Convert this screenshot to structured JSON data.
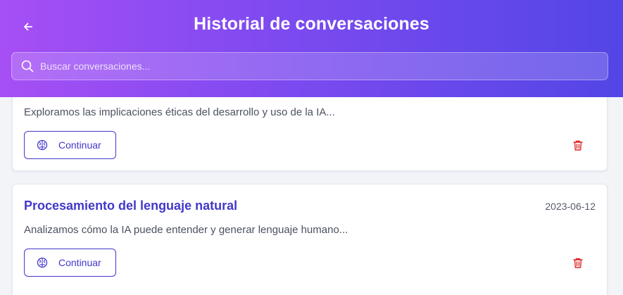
{
  "header": {
    "title": "Historial de conversaciones",
    "back_icon": "arrow-left-icon"
  },
  "search": {
    "placeholder": "Buscar conversaciones...",
    "value": "",
    "icon": "search-icon"
  },
  "conversations": [
    {
      "title": "",
      "date": "",
      "description": "Exploramos las implicaciones éticas del desarrollo y uso de la IA...",
      "continue_label": "Continuar",
      "continue_icon": "brain-icon",
      "delete_icon": "trash-icon"
    },
    {
      "title": "Procesamiento del lenguaje natural",
      "date": "2023-06-12",
      "description": "Analizamos cómo la IA puede entender y generar lenguaje humano...",
      "continue_label": "Continuar",
      "continue_icon": "brain-icon",
      "delete_icon": "trash-icon"
    }
  ],
  "colors": {
    "header_gradient_start": "#a64ff5",
    "header_gradient_end": "#5346e6",
    "accent": "#4338ca",
    "delete": "#dc2626"
  }
}
